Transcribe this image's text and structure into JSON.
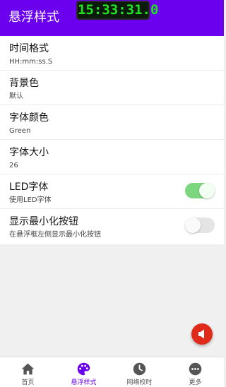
{
  "header": {
    "title": "悬浮样式",
    "clock": "15:33:31.0"
  },
  "settings": [
    {
      "title": "时间格式",
      "subtitle": "HH:mm:ss.S"
    },
    {
      "title": "背景色",
      "subtitle": "默认"
    },
    {
      "title": "字体颜色",
      "subtitle": "Green"
    },
    {
      "title": "字体大小",
      "subtitle": "26"
    },
    {
      "title": "LED字体",
      "subtitle": "使用LED字体",
      "toggle": true
    },
    {
      "title": "显示最小化按钮",
      "subtitle": "在悬浮框左侧显示最小化按钮",
      "toggle": false
    }
  ],
  "fab": {
    "icon": "volume-icon"
  },
  "bottom_nav": [
    {
      "label": "首页",
      "icon": "home-icon"
    },
    {
      "label": "悬浮样式",
      "icon": "palette-icon",
      "active": true
    },
    {
      "label": "网络校时",
      "icon": "clock-icon"
    },
    {
      "label": "更多",
      "icon": "more-icon"
    }
  ],
  "colors": {
    "primary": "#6a00ee",
    "led_green": "#21e321",
    "toggle_on": "#7bd67d",
    "fab": "#e02a1a"
  }
}
